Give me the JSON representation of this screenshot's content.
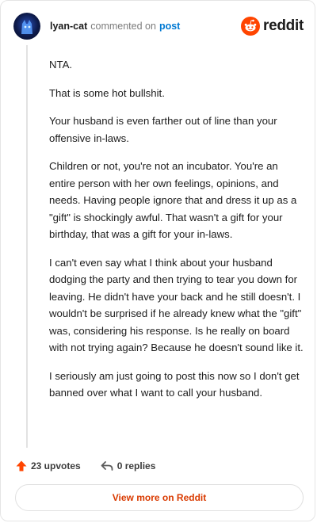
{
  "header": {
    "username": "lyan-cat",
    "action_text": "commented on",
    "post_link": "post",
    "brand": "reddit"
  },
  "comment": {
    "paragraphs": [
      "NTA.",
      "That is some hot bullshit.",
      "Your husband is even farther out of line than your offensive in-laws.",
      "Children or not, you're not an incubator. You're an entire person with her own feelings, opinions, and needs. Having people ignore that and dress it up as a \"gift\" is shockingly awful. That wasn't a gift for your birthday, that was a gift for your in-laws.",
      "I can't even say what I think about your husband dodging the party and then trying to tear you down for leaving. He didn't have your back and he still doesn't. I wouldn't be surprised if he already knew what the \"gift\" was, considering his response. Is he really on board with not trying again? Because he doesn't sound like it.",
      "I seriously am just going to post this now so I don't get banned over what I want to call your husband."
    ]
  },
  "footer": {
    "upvotes": "23 upvotes",
    "replies": "0 replies",
    "view_more": "View more on Reddit"
  },
  "colors": {
    "accent": "#ff4500",
    "link": "#0079d3",
    "view_more_text": "#d93a00"
  },
  "icons": {
    "avatar": "cat-avatar",
    "brand": "reddit-alien-icon",
    "upvote": "upvote-arrow-icon",
    "reply": "reply-arrow-icon"
  }
}
